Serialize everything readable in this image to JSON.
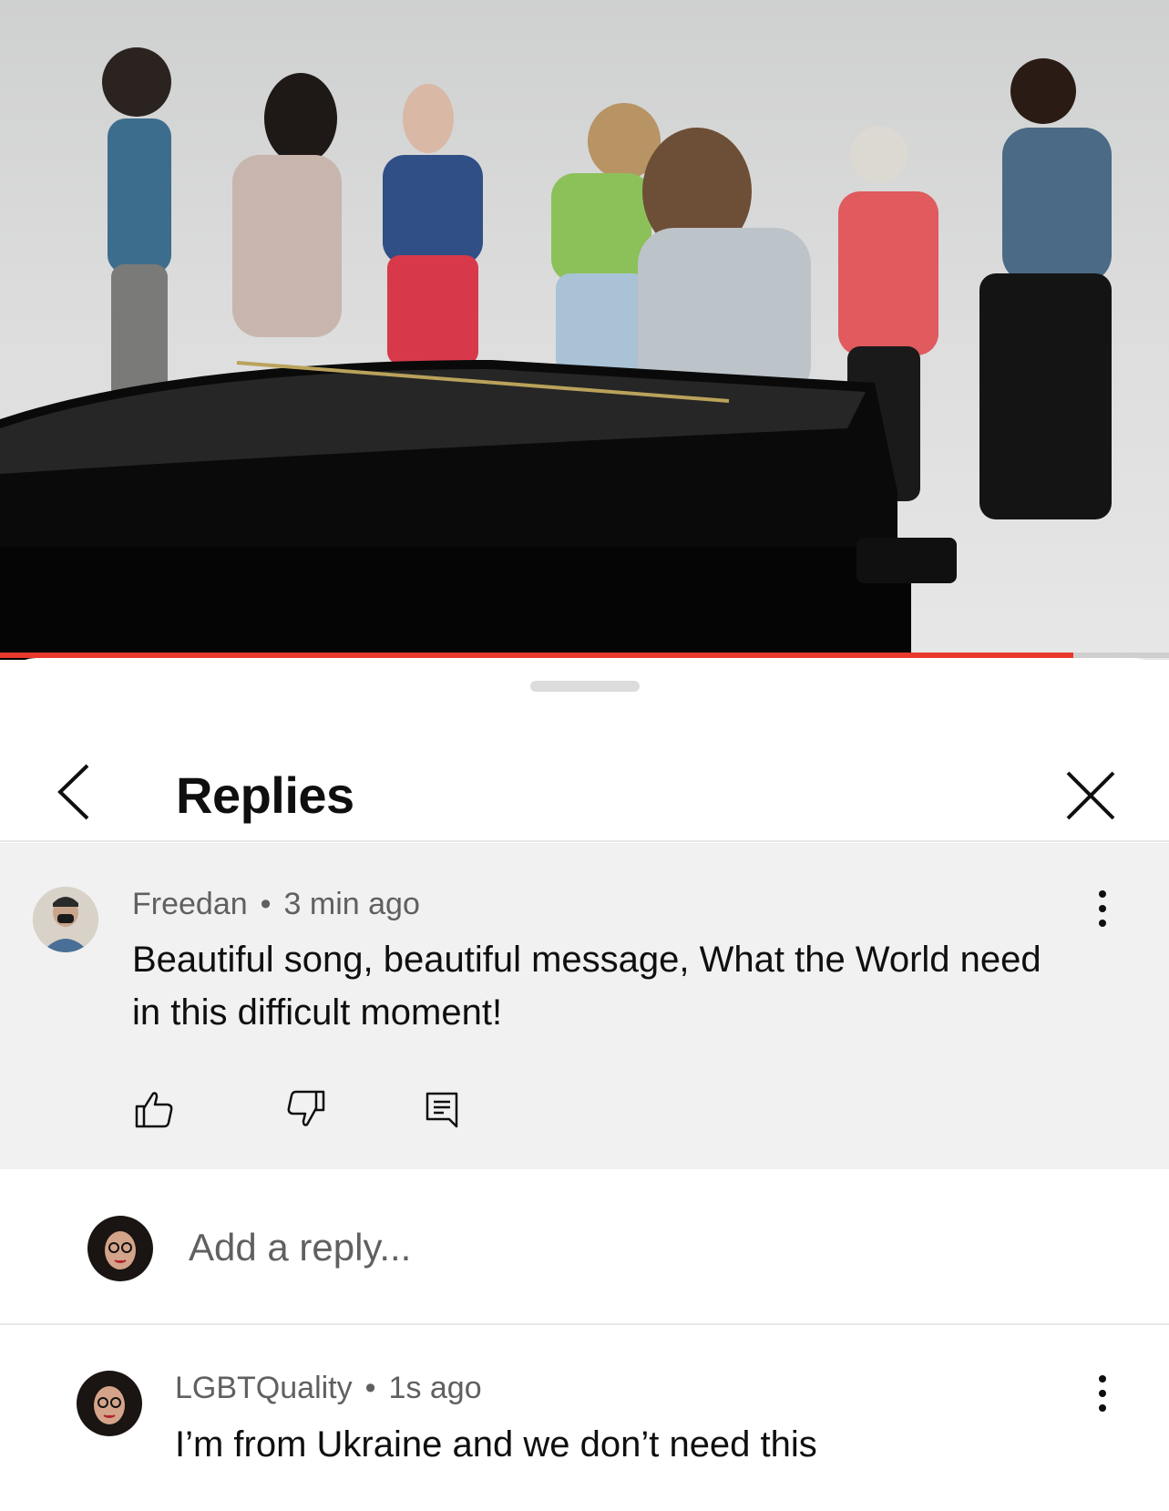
{
  "video": {
    "progress_fraction": 0.918,
    "progress_color": "#e8392b"
  },
  "sheet": {
    "title": "Replies",
    "back_icon": "chevron-left-icon",
    "close_icon": "close-icon"
  },
  "parent_comment": {
    "author": "Freedan",
    "separator": "•",
    "time": "3 min ago",
    "text_line1": "Beautiful song, beautiful message, What the World need",
    "text_line2": "in this difficult moment!",
    "actions": [
      "thumbs-up-icon",
      "thumbs-down-icon",
      "reply-comment-icon"
    ],
    "menu_icon": "more-vertical-icon"
  },
  "reply_input": {
    "placeholder": "Add a reply..."
  },
  "reply_comment": {
    "author": "LGBTQuality",
    "separator": "•",
    "time": "1s ago",
    "text": "I’m from Ukraine and we don’t need this",
    "menu_icon": "more-vertical-icon"
  }
}
